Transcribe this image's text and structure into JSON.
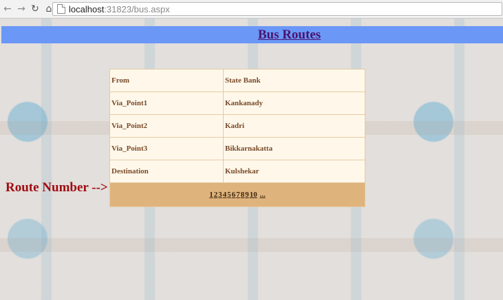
{
  "browser": {
    "url_host": "localhost",
    "url_rest": ":31823/bus.aspx"
  },
  "page": {
    "title": "Bus Routes",
    "route_label": "Route Number -->"
  },
  "route": {
    "rows": [
      {
        "key": "From",
        "value": "State Bank"
      },
      {
        "key": "Via_Point1",
        "value": "Kankanady"
      },
      {
        "key": "Via_Point2",
        "value": "Kadri"
      },
      {
        "key": "Via_Point3",
        "value": "Bikkarnakatta"
      },
      {
        "key": "Destination",
        "value": "Kulshekar"
      }
    ],
    "pager": [
      "1",
      "2",
      "3",
      "4",
      "5",
      "6",
      "7",
      "8",
      "9",
      "10",
      "..."
    ]
  }
}
